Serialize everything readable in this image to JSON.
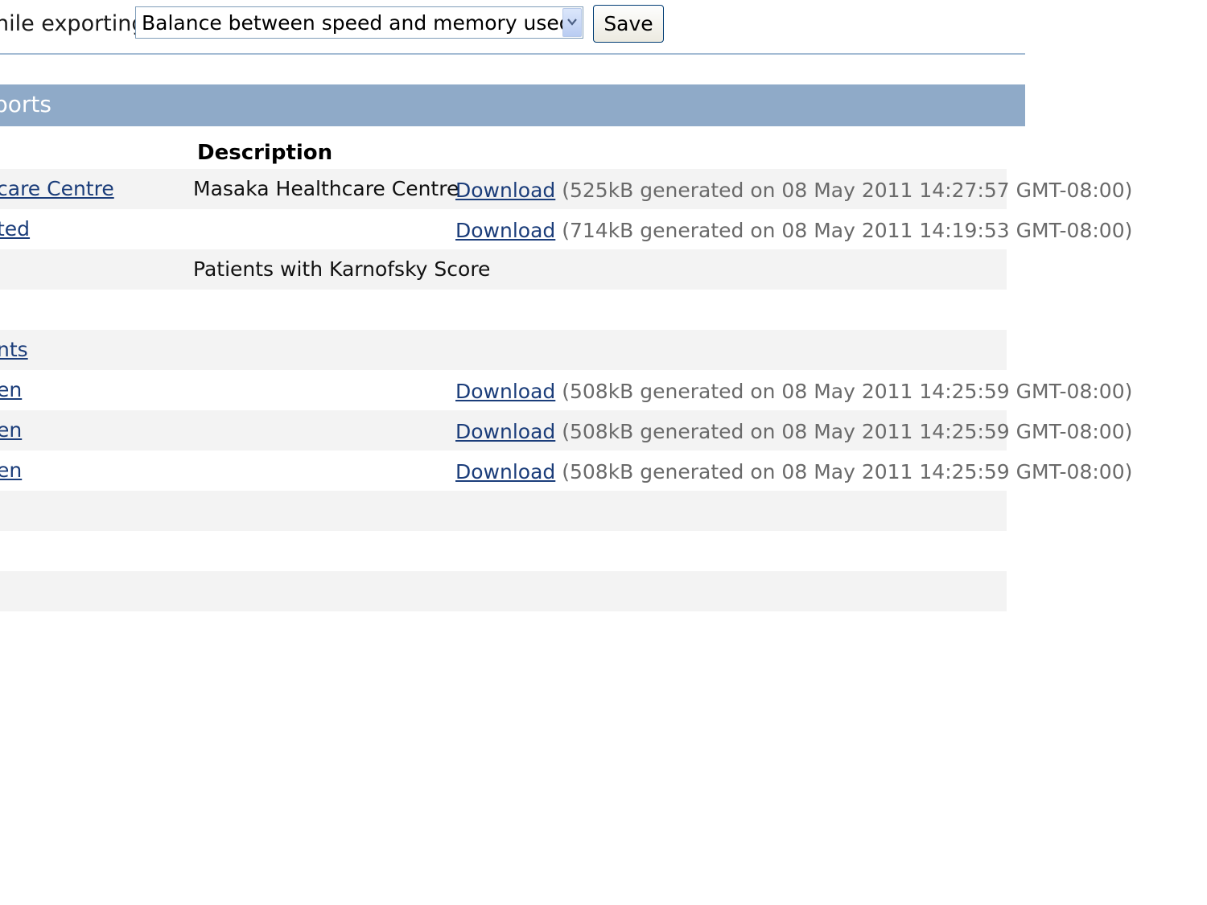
{
  "toolbar": {
    "export_label": "hile exporting:",
    "select_value": "Balance between speed and memory used",
    "save_label": "Save"
  },
  "section": {
    "title": "ports"
  },
  "table": {
    "columns": {
      "description": "Description"
    },
    "rows": [
      {
        "name": "care Centre",
        "description": "Masaka Healthcare Centre",
        "download": "Download",
        "info": " (525kB generated on 08 May 2011 14:27:57 GMT-08:00)"
      },
      {
        "name": "ted",
        "description": "",
        "download": "Download",
        "info": " (714kB generated on 08 May 2011 14:19:53 GMT-08:00)"
      },
      {
        "name": "",
        "description": "Patients with Karnofsky Score",
        "download": "",
        "info": ""
      },
      {
        "name": "",
        "description": "",
        "download": "",
        "info": ""
      },
      {
        "name": "nts",
        "description": "",
        "download": "",
        "info": ""
      },
      {
        "name": "en",
        "description": "",
        "download": "Download",
        "info": " (508kB generated on 08 May 2011 14:25:59 GMT-08:00)"
      },
      {
        "name": "en",
        "description": "",
        "download": "Download",
        "info": " (508kB generated on 08 May 2011 14:25:59 GMT-08:00)"
      },
      {
        "name": "en",
        "description": "",
        "download": "Download",
        "info": " (508kB generated on 08 May 2011 14:25:59 GMT-08:00)"
      },
      {
        "name": "",
        "description": "",
        "download": "",
        "info": ""
      },
      {
        "name": "",
        "description": "",
        "download": "",
        "info": ""
      },
      {
        "name": "",
        "description": "",
        "download": "",
        "info": ""
      }
    ]
  },
  "colors": {
    "header_bar": "#8faac8",
    "row_alt": "#f3f3f3",
    "link": "#1b3d7a",
    "info_text": "#6a6a6a"
  }
}
